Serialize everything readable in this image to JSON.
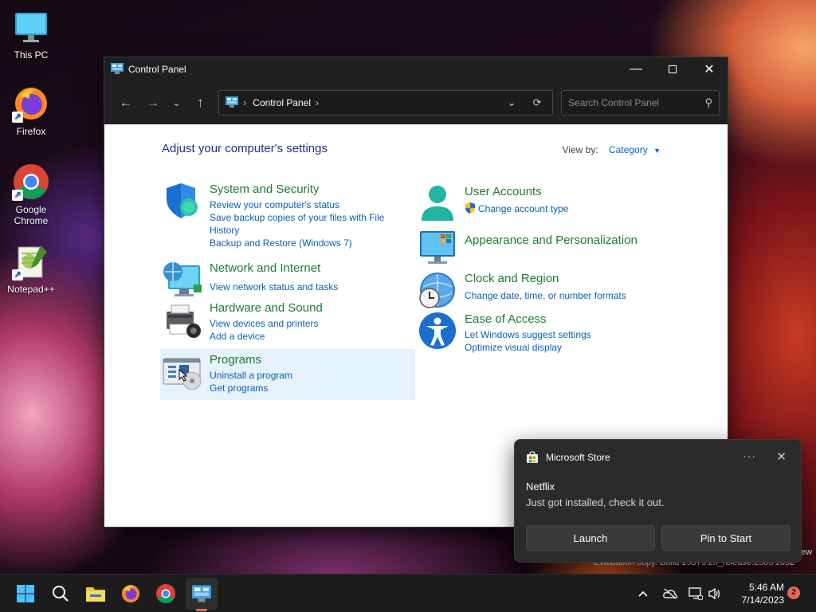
{
  "desktop": {
    "icons": [
      {
        "label": "This PC"
      },
      {
        "label": "Firefox"
      },
      {
        "label": "Google Chrome"
      },
      {
        "label": "Notepad++"
      }
    ]
  },
  "window": {
    "title": "Control Panel",
    "address": {
      "crumb": "Control Panel",
      "separator": "›"
    },
    "search": {
      "placeholder": "Search Control Panel"
    },
    "heading": "Adjust your computer's settings",
    "view_by": {
      "label": "View by:",
      "value": "Category"
    },
    "left_categories": [
      {
        "title": "System and Security",
        "links": [
          "Review your computer's status",
          "Save backup copies of your files with File History",
          "Backup and Restore (Windows 7)"
        ]
      },
      {
        "title": "Network and Internet",
        "links": [
          "View network status and tasks"
        ]
      },
      {
        "title": "Hardware and Sound",
        "links": [
          "View devices and printers",
          "Add a device"
        ]
      },
      {
        "title": "Programs",
        "links": [
          "Uninstall a program",
          "Get programs"
        ]
      }
    ],
    "right_categories": [
      {
        "title": "User Accounts",
        "links": [
          "Change account type"
        ]
      },
      {
        "title": "Appearance and Personalization",
        "links": []
      },
      {
        "title": "Clock and Region",
        "links": [
          "Change date, time, or number formats"
        ]
      },
      {
        "title": "Ease of Access",
        "links": [
          "Let Windows suggest settings",
          "Optimize visual display"
        ]
      }
    ]
  },
  "notification": {
    "source": "Microsoft Store",
    "app": "Netflix",
    "message": "Just got installed, check it out.",
    "primary_button": "Launch",
    "secondary_button": "Pin to Start"
  },
  "watermark": {
    "line": "Evaluation copy. Build 25375.zn_release.2305 1632",
    "edge_text": "ew"
  },
  "taskbar": {
    "time": "5:46 AM",
    "date": "7/14/2023",
    "notification_count": "2"
  }
}
